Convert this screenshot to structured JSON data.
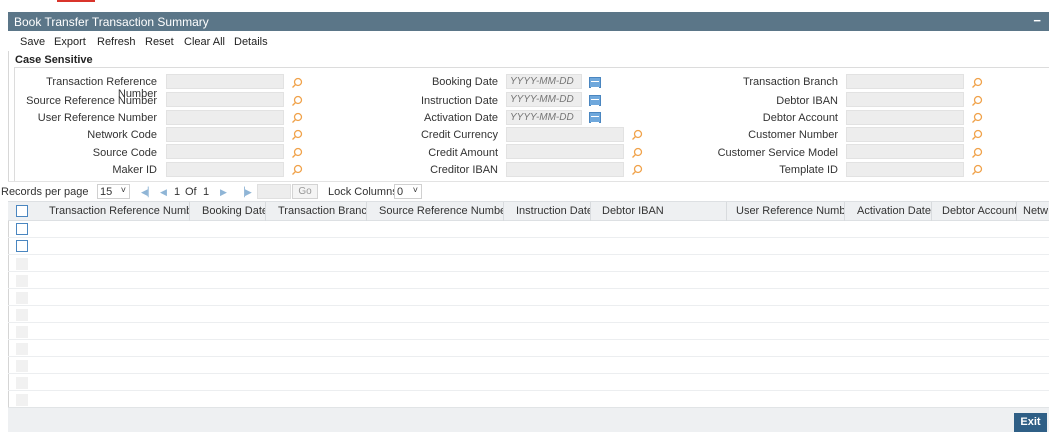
{
  "window": {
    "title": "Book Transfer Transaction Summary",
    "minimize_glyph": "−"
  },
  "toolbar": {
    "items": [
      "Save",
      "Export",
      "Refresh",
      "Reset",
      "Clear All",
      "Details"
    ]
  },
  "search": {
    "section_title": "Case Sensitive",
    "date_placeholder": "YYYY-MM-DD",
    "col1": [
      "Transaction Reference Number",
      "Source Reference Number",
      "User Reference Number",
      "Network Code",
      "Source Code",
      "Maker ID"
    ],
    "col2": [
      "Booking Date",
      "Instruction Date",
      "Activation Date",
      "Credit Currency",
      "Credit Amount",
      "Creditor IBAN"
    ],
    "col3": [
      "Transaction Branch",
      "Debtor IBAN",
      "Debtor Account",
      "Customer Number",
      "Customer Service Model",
      "Template ID"
    ]
  },
  "pager": {
    "records_label": "Records per page",
    "records_value": "15",
    "page_current": "1",
    "of_label": "Of",
    "page_total": "1",
    "go_label": "Go",
    "lock_label": "Lock Columns",
    "lock_value": "0"
  },
  "grid": {
    "columns": [
      "Transaction Reference Number",
      "Booking Date",
      "Transaction Branch",
      "Source Reference Number",
      "Instruction Date",
      "Debtor IBAN",
      "User Reference Number",
      "Activation Date",
      "Debtor Account",
      "Netw"
    ]
  },
  "footer": {
    "exit_label": "Exit"
  },
  "icons": {
    "search": "search-icon",
    "calendar": "calendar-icon",
    "chevron": "chevron-down-icon"
  },
  "colors": {
    "titlebar": "#5b7688",
    "accent": "#2f5f86",
    "icon_blue": "#6fa8dc"
  }
}
